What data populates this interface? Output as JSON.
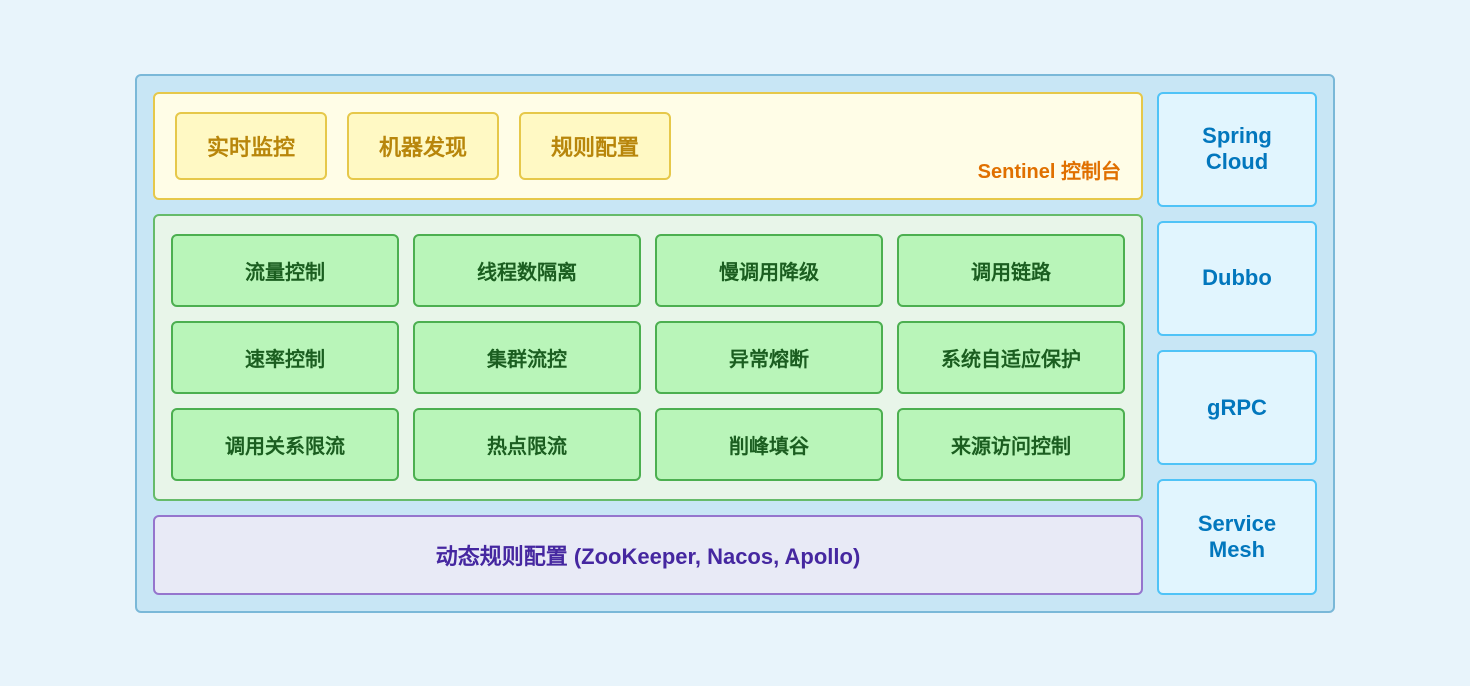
{
  "sentinel": {
    "box1": "实时监控",
    "box2": "机器发现",
    "box3": "规则配置",
    "label": "Sentinel 控制台"
  },
  "core": {
    "items": [
      "流量控制",
      "线程数隔离",
      "慢调用降级",
      "调用链路",
      "速率控制",
      "集群流控",
      "异常熔断",
      "系统自适应保护",
      "调用关系限流",
      "热点限流",
      "削峰填谷",
      "来源访问控制"
    ]
  },
  "dynamic": {
    "label": "动态规则配置 (ZooKeeper, Nacos, Apollo)"
  },
  "sidebar": {
    "items": [
      "Spring Cloud",
      "Dubbo",
      "gRPC",
      "Service Mesh"
    ]
  }
}
